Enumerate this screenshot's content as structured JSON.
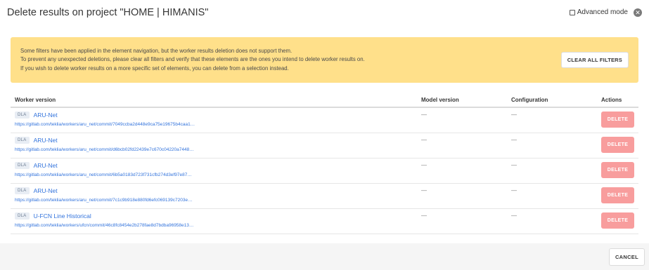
{
  "header": {
    "title": "Delete results on project \"HOME | HIMANIS\"",
    "advanced_mode_label": "Advanced mode",
    "close_glyph": "✕"
  },
  "notice": {
    "lines": [
      "Some filters have been applied in the element navigation, but the worker results deletion does not support them.",
      "To prevent any unexpected deletions, please clear all filters and verify that these elements are the ones you intend to delete worker results on.",
      "If you wish to delete worker results on a more specific set of elements, you can delete from a selection instead."
    ],
    "clear_button": "CLEAR ALL FILTERS"
  },
  "table": {
    "columns": [
      "Worker version",
      "Model version",
      "Configuration",
      "Actions"
    ],
    "rows": [
      {
        "tag": "DLA",
        "name": "ARU-Net",
        "url": "https://gitlab.com/teklia/workers/aru_net/commit/7049ccba2d448e9ca75e19675b4caa1…",
        "model": "—",
        "config": "—",
        "action": "DELETE"
      },
      {
        "tag": "DLA",
        "name": "ARU-Net",
        "url": "https://gitlab.com/teklia/workers/aru_net/commit/d6bcb02fd22439e7c670c04220a7448…",
        "model": "—",
        "config": "—",
        "action": "DELETE"
      },
      {
        "tag": "DLA",
        "name": "ARU-Net",
        "url": "https://gitlab.com/teklia/workers/aru_net/commit/6b5a0183d723f731cfb274d3ef97e87…",
        "model": "—",
        "config": "—",
        "action": "DELETE"
      },
      {
        "tag": "DLA",
        "name": "ARU-Net",
        "url": "https://gitlab.com/teklia/workers/aru_net/commit/7c1c9b918e880fd6efc069139c7203e…",
        "model": "—",
        "config": "—",
        "action": "DELETE"
      },
      {
        "tag": "DLA",
        "name": "U-FCN Line Historical",
        "url": "https://gitlab.com/teklia/workers/ufcn/commit/46c8fc8454e2b278fae8d7bdba96958e13…",
        "model": "—",
        "config": "—",
        "action": "DELETE"
      }
    ]
  },
  "footer": {
    "cancel_button": "CANCEL"
  },
  "colors": {
    "notice_bg": "#ffe08a",
    "link": "#3273dc",
    "delete_bg": "#f89d9d"
  }
}
